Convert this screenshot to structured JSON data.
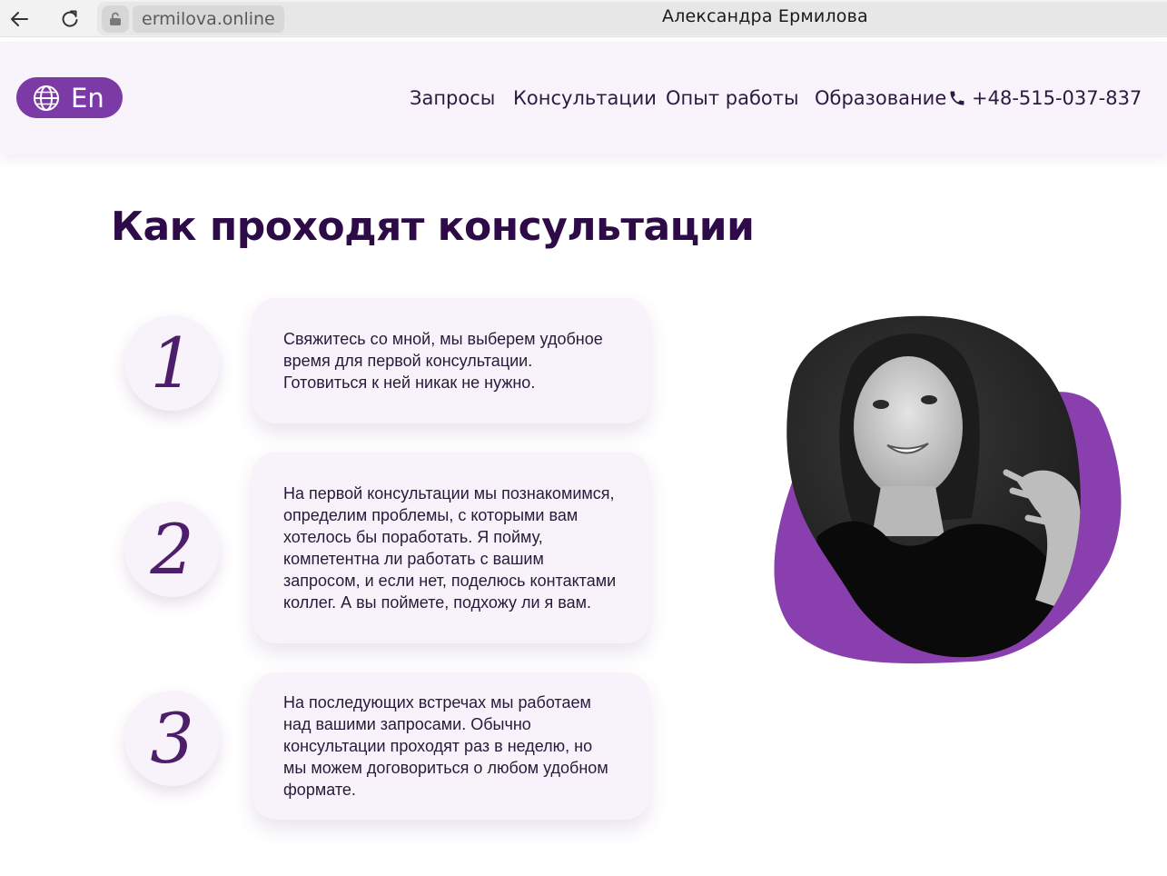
{
  "browser": {
    "domain": "ermilova.online",
    "tab_title": "Александра Ермилова"
  },
  "header": {
    "language_label": "En",
    "menu": [
      "Запросы",
      "Консультации",
      "Опыт работы",
      "Образование"
    ],
    "phone": "+48-515-037-837"
  },
  "section": {
    "title": "Как проходят консультации",
    "steps": [
      {
        "number": "1",
        "text": "Свяжитесь со мной, мы выберем удобное время для первой консультации. Готовиться к ней никак не нужно."
      },
      {
        "number": "2",
        "text": "На первой консультации мы познакомимся, определим проблемы, с которыми вам хотелось бы поработать. Я пойму, компетентна ли работать с вашим запросом, и если нет, поделюсь контактами коллег. А вы поймете, подхожу ли я вам."
      },
      {
        "number": "3",
        "text": "На последующих встречах мы работаем над вашими запросами. Обычно консультации проходят раз в неделю, но мы можем договориться о любом удобном формате."
      }
    ]
  },
  "colors": {
    "accent": "#7b3aa6",
    "blob": "#8a3fae",
    "title": "#2e0b48",
    "card_bg": "#f8f2fa"
  },
  "icons": {
    "back": "arrow-left-icon",
    "reload": "reload-icon",
    "lock": "lock-icon",
    "globe": "globe-icon",
    "phone": "phone-icon"
  }
}
